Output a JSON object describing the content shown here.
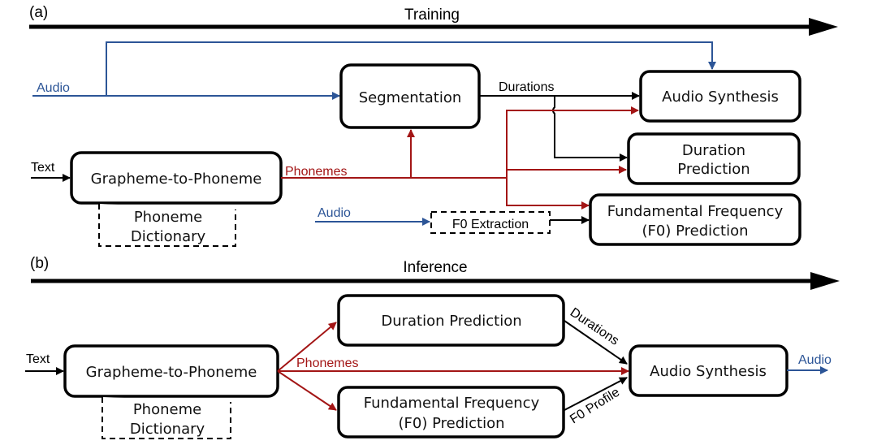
{
  "colors": {
    "audio": "#2c5597",
    "phonemes": "#a31515",
    "default": "#000000"
  },
  "training": {
    "panel_label": "(a)",
    "title": "Training",
    "inputs": {
      "audio_top": "Audio",
      "text": "Text",
      "audio_bottom": "Audio"
    },
    "boxes": {
      "segmentation": "Segmentation",
      "audio_synthesis": "Audio Synthesis",
      "duration_prediction_line1": "Duration",
      "duration_prediction_line2": "Prediction",
      "g2p": "Grapheme-to-Phoneme",
      "phoneme_dictionary_line1": "Phoneme",
      "phoneme_dictionary_line2": "Dictionary",
      "f0_extraction": "F0 Extraction",
      "f0_prediction_line1": "Fundamental Frequency",
      "f0_prediction_line2": "(F0) Prediction"
    },
    "edge_labels": {
      "durations": "Durations",
      "phonemes": "Phonemes"
    }
  },
  "inference": {
    "panel_label": "(b)",
    "title": "Inference",
    "inputs": {
      "text": "Text"
    },
    "outputs": {
      "audio": "Audio"
    },
    "boxes": {
      "g2p": "Grapheme-to-Phoneme",
      "phoneme_dictionary_line1": "Phoneme",
      "phoneme_dictionary_line2": "Dictionary",
      "duration_prediction": "Duration Prediction",
      "f0_prediction_line1": "Fundamental Frequency",
      "f0_prediction_line2": "(F0) Prediction",
      "audio_synthesis": "Audio Synthesis"
    },
    "edge_labels": {
      "phonemes": "Phonemes",
      "durations": "Durations",
      "f0_profile": "F0 Profile"
    }
  }
}
